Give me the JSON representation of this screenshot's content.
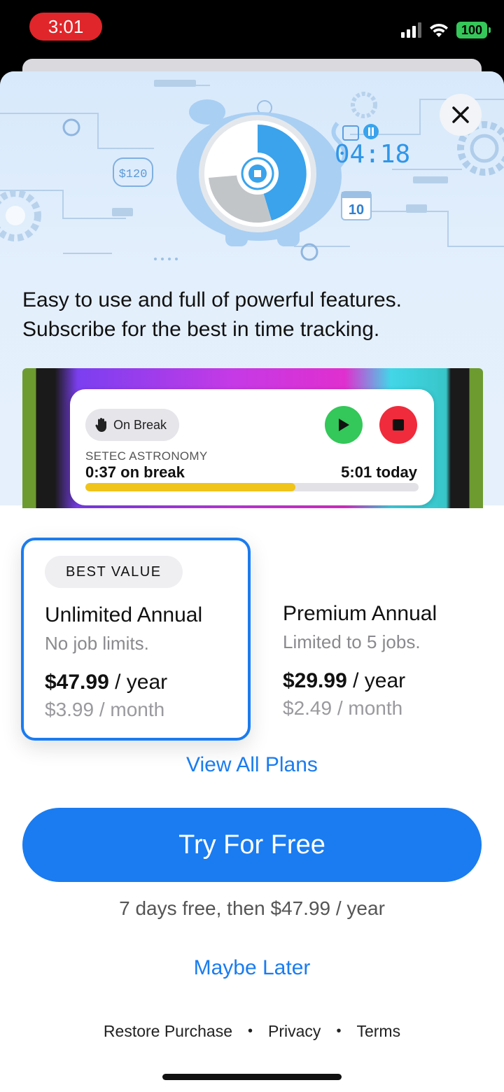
{
  "status_bar": {
    "time": "3:01",
    "battery": "100"
  },
  "hero": {
    "price_tag": "$120",
    "clock_display": "04:18",
    "calendar_day": "10"
  },
  "headline": {
    "line1": "Easy to use and full of powerful features.",
    "line2": "Subscribe for the best in time tracking."
  },
  "preview": {
    "status_pill": "On Break",
    "job_name": "SETEC ASTRONOMY",
    "break_time": "0:37 on break",
    "today_time": "5:01 today",
    "progress_fraction": 0.63
  },
  "plans": [
    {
      "badge": "BEST VALUE",
      "name": "Unlimited Annual",
      "subtitle": "No job limits.",
      "price": "$47.99",
      "period": " / year",
      "monthly": "$3.99 / month",
      "selected": true
    },
    {
      "name": "Premium Annual",
      "subtitle": "Limited to 5 jobs.",
      "price": "$29.99",
      "period": " / year",
      "monthly": "$2.49 / month",
      "selected": false
    }
  ],
  "view_all_plans": "View All Plans",
  "cta_label": "Try For Free",
  "trial_note": "7 days free, then $47.99 / year",
  "maybe_later": "Maybe Later",
  "footer": {
    "restore": "Restore Purchase",
    "privacy": "Privacy",
    "terms": "Terms",
    "separator": "•"
  },
  "colors": {
    "accent": "#1a7cf0",
    "play": "#34c759",
    "stop": "#ef2b3c",
    "progress": "#f0c419"
  }
}
